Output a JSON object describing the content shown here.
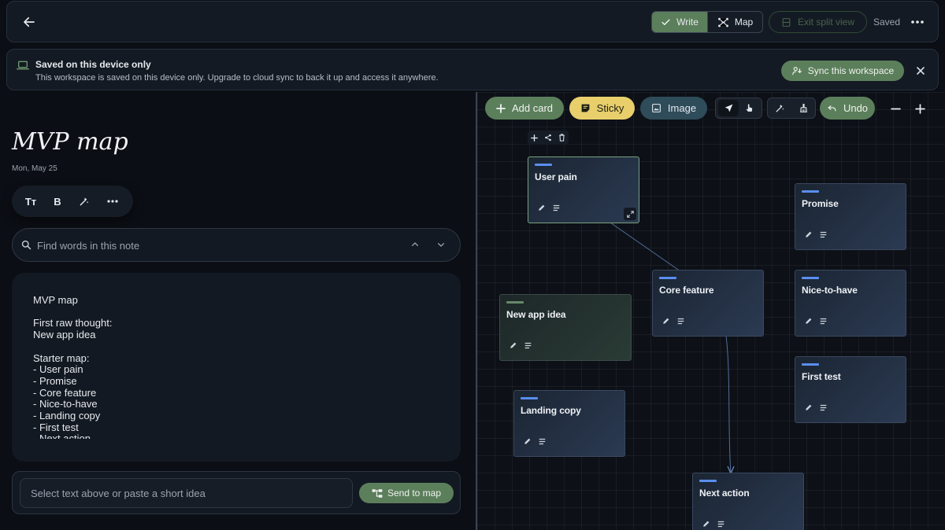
{
  "topbar": {
    "write_label": "Write",
    "map_label": "Map",
    "exit_label": "Exit split view",
    "status": "Saved"
  },
  "banner": {
    "title": "Saved on this device only",
    "body": "This workspace is saved on this device only. Upgrade to cloud sync to back it up and access it anywhere.",
    "sync_label": "Sync this workspace"
  },
  "note": {
    "title": "MVP map",
    "date": "Mon, May 25",
    "format_text_label": "Tт",
    "bold_label": "B",
    "search_placeholder": "Find words in this note",
    "body": "MVP map\n\nFirst raw thought:\nNew app idea\n\nStarter map:\n- User pain\n- Promise\n- Core feature\n- Nice-to-have\n- Landing copy\n- First test\n- Next action",
    "idea_placeholder": "Select text above or paste a short idea",
    "send_label": "Send to map"
  },
  "map": {
    "toolbar": {
      "add_card": "Add card",
      "sticky": "Sticky",
      "image": "Image",
      "undo": "Undo"
    },
    "cards": [
      {
        "title": "User pain"
      },
      {
        "title": "Promise"
      },
      {
        "title": "Core feature"
      },
      {
        "title": "Nice-to-have"
      },
      {
        "title": "New app idea"
      },
      {
        "title": "First test"
      },
      {
        "title": "Landing copy"
      },
      {
        "title": "Next action"
      }
    ]
  },
  "colors": {
    "accent_green": "#5c7f5b",
    "sticky_yellow": "#e8cf6b",
    "card_bar_blue": "#5a8ef0"
  }
}
